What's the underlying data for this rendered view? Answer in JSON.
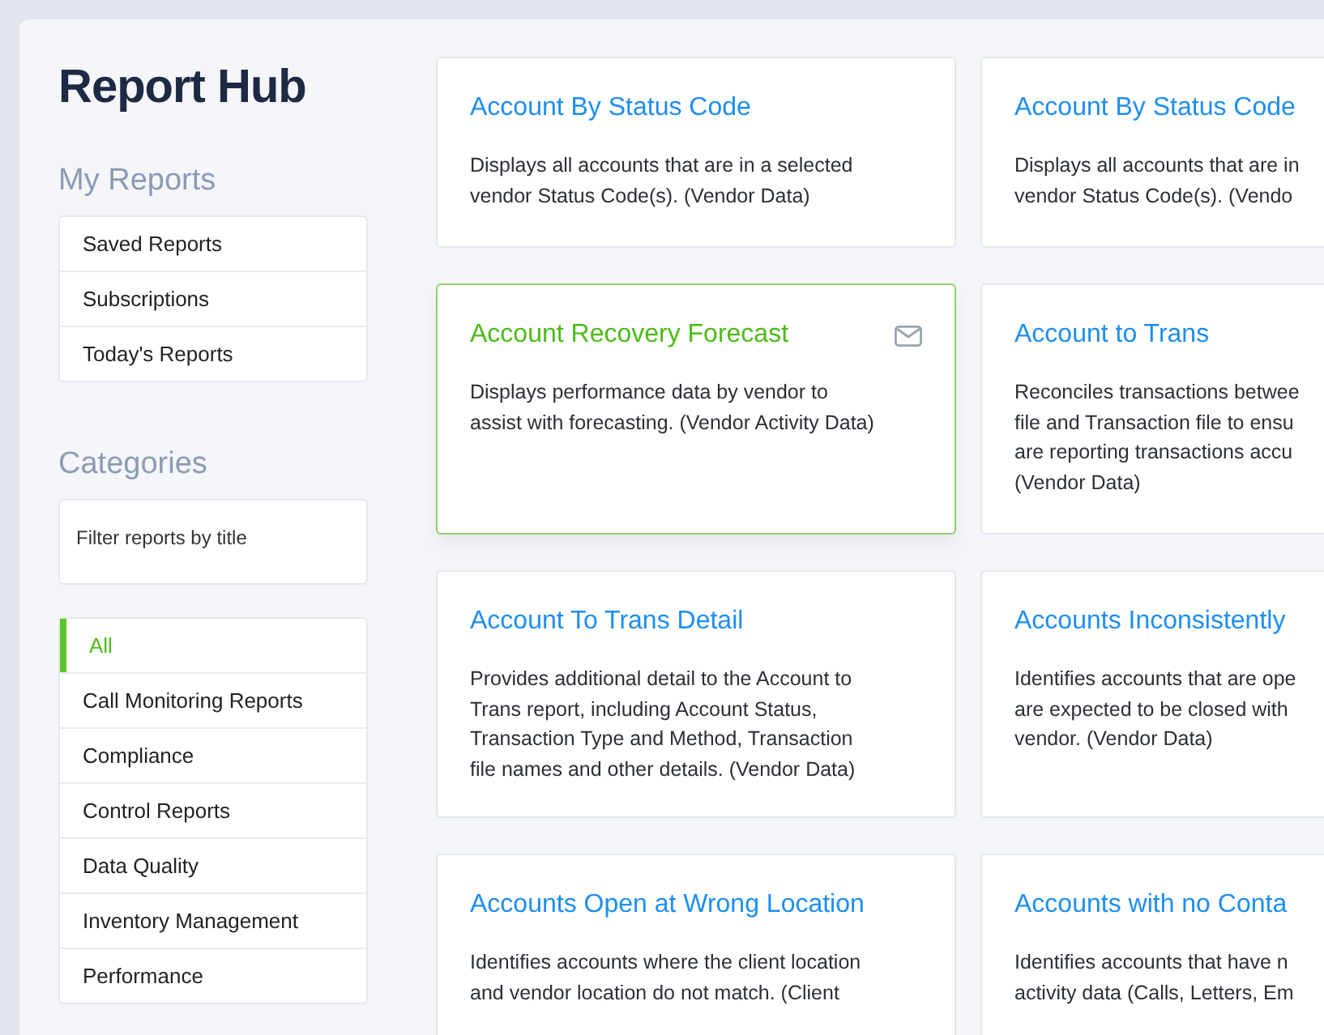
{
  "title": "Report Hub",
  "my_reports": {
    "heading": "My Reports",
    "items": [
      "Saved Reports",
      "Subscriptions",
      "Today's Reports"
    ]
  },
  "categories": {
    "heading": "Categories",
    "filter": {
      "placeholder": "Filter reports by title"
    },
    "items": [
      {
        "label": "All",
        "selected": true
      },
      {
        "label": "Call Monitoring Reports",
        "selected": false
      },
      {
        "label": "Compliance",
        "selected": false
      },
      {
        "label": "Control Reports",
        "selected": false
      },
      {
        "label": "Data Quality",
        "selected": false
      },
      {
        "label": "Inventory Management",
        "selected": false
      },
      {
        "label": "Performance",
        "selected": false
      }
    ]
  },
  "reports": [
    {
      "title": "Account By Status Code",
      "description": [
        "Displays all accounts that are in a selected",
        "vendor Status Code(s). (Vendor Data)"
      ],
      "selected": false
    },
    {
      "title": "Account By Status Code",
      "description": [
        "Displays all accounts that are in",
        "vendor Status Code(s). (Vendo"
      ],
      "selected": false
    },
    {
      "title": "Account Recovery Forecast",
      "description": [
        "Displays performance data by vendor to",
        "assist with forecasting. (Vendor Activity Data)"
      ],
      "selected": true
    },
    {
      "title": "Account to Trans",
      "description": [
        "Reconciles transactions betwee",
        "file and Transaction file to ensu",
        "are reporting transactions accu",
        "(Vendor Data)"
      ],
      "selected": false
    },
    {
      "title": "Account To Trans Detail",
      "description": [
        "Provides additional detail to the Account to",
        "Trans report, including Account Status,",
        "Transaction Type and Method, Transaction",
        "file names and other details. (Vendor Data)"
      ],
      "selected": false
    },
    {
      "title": "Accounts Inconsistently",
      "description": [
        "Identifies accounts that are ope",
        "are expected to be closed with",
        "vendor. (Vendor Data)"
      ],
      "selected": false
    },
    {
      "title": "Accounts Open at Wrong Location",
      "description": [
        "Identifies accounts where the client location",
        "and vendor location do not match. (Client"
      ],
      "selected": false
    },
    {
      "title": "Accounts with no Conta",
      "description": [
        "Identifies accounts that have n",
        "activity data (Calls, Letters, Em"
      ],
      "selected": false
    }
  ]
}
